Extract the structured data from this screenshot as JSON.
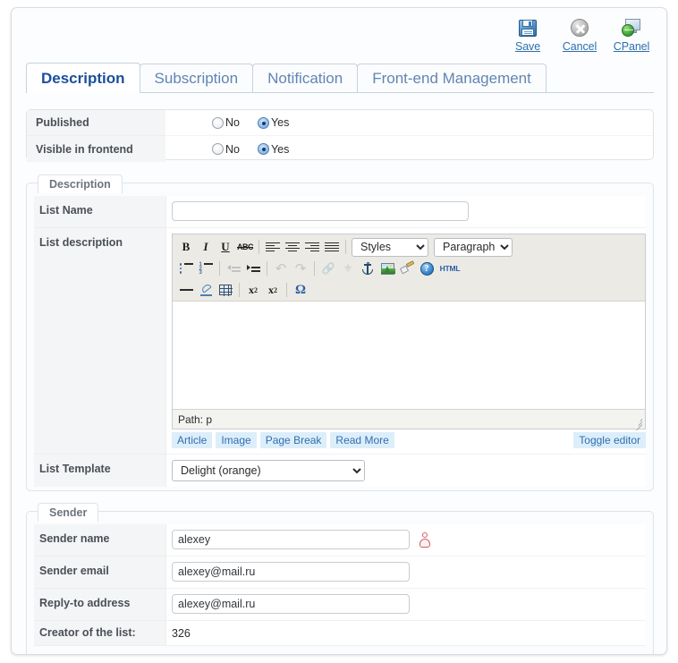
{
  "toolbar": {
    "buttons": [
      {
        "label": "Save",
        "icon": "floppy-disk-icon"
      },
      {
        "label": "Cancel",
        "icon": "cancel-circle-icon"
      },
      {
        "label": "CPanel",
        "icon": "cpanel-globe-icon"
      }
    ]
  },
  "tabs": [
    {
      "label": "Description",
      "active": true
    },
    {
      "label": "Subscription",
      "active": false
    },
    {
      "label": "Notification",
      "active": false
    },
    {
      "label": "Front-end Management",
      "active": false
    }
  ],
  "flags": {
    "rows": [
      {
        "label": "Published",
        "options": [
          "No",
          "Yes"
        ],
        "selected": "Yes"
      },
      {
        "label": "Visible in frontend",
        "options": [
          "No",
          "Yes"
        ],
        "selected": "Yes"
      }
    ]
  },
  "description_fieldset": {
    "legend": "Description",
    "list_name": {
      "label": "List Name",
      "value": "",
      "placeholder": ""
    },
    "list_description": {
      "label": "List description"
    },
    "list_template": {
      "label": "List Template",
      "value": "Delight (orange)",
      "options": [
        "Delight (orange)"
      ]
    }
  },
  "editor": {
    "row1": [
      {
        "name": "bold-icon",
        "title": "Bold"
      },
      {
        "name": "italic-icon",
        "title": "Italic"
      },
      {
        "name": "underline-icon",
        "title": "Underline"
      },
      {
        "name": "strikethrough-icon",
        "title": "Strikethrough"
      },
      {
        "name": "align-left-icon",
        "title": "Align left"
      },
      {
        "name": "align-center-icon",
        "title": "Align center"
      },
      {
        "name": "align-right-icon",
        "title": "Align right"
      },
      {
        "name": "align-justify-icon",
        "title": "Justify"
      }
    ],
    "styles_select": {
      "value": "Styles",
      "options": [
        "Styles"
      ]
    },
    "paragraph_select": {
      "value": "Paragraph",
      "options": [
        "Paragraph"
      ]
    },
    "row2": [
      {
        "name": "bullet-list-icon",
        "title": "Unordered list"
      },
      {
        "name": "numbered-list-icon",
        "title": "Ordered list"
      },
      {
        "name": "outdent-icon",
        "title": "Outdent",
        "disabled": true
      },
      {
        "name": "indent-icon",
        "title": "Indent"
      },
      {
        "name": "undo-icon",
        "title": "Undo",
        "disabled": true
      },
      {
        "name": "redo-icon",
        "title": "Redo",
        "disabled": true
      },
      {
        "name": "link-icon",
        "title": "Insert link",
        "disabled": true
      },
      {
        "name": "unlink-icon",
        "title": "Unlink",
        "disabled": true
      },
      {
        "name": "anchor-icon",
        "title": "Insert anchor"
      },
      {
        "name": "image-icon",
        "title": "Insert image"
      },
      {
        "name": "cleanup-brush-icon",
        "title": "Cleanup code"
      },
      {
        "name": "help-icon",
        "title": "Help"
      },
      {
        "name": "html-source-icon",
        "title": "Edit HTML source",
        "text": "HTML"
      }
    ],
    "row3": [
      {
        "name": "horizontal-rule-icon",
        "title": "Insert horizontal rule"
      },
      {
        "name": "eraser-icon",
        "title": "Remove formatting"
      },
      {
        "name": "table-icon",
        "title": "Insert table"
      },
      {
        "name": "subscript-icon",
        "title": "Subscript"
      },
      {
        "name": "superscript-icon",
        "title": "Superscript"
      },
      {
        "name": "special-char-icon",
        "title": "Insert special character",
        "text": "Ω"
      }
    ],
    "content": "",
    "status_path": "Path: p",
    "extended_buttons": [
      {
        "label": "Article"
      },
      {
        "label": "Image"
      },
      {
        "label": "Page Break"
      },
      {
        "label": "Read More"
      }
    ],
    "toggle_label": "Toggle editor"
  },
  "sender_fieldset": {
    "legend": "Sender",
    "rows": [
      {
        "label": "Sender name",
        "value": "alexey",
        "type": "input",
        "icon": "user-icon"
      },
      {
        "label": "Sender email",
        "value": "alexey@mail.ru",
        "type": "input"
      },
      {
        "label": "Reply-to address",
        "value": "alexey@mail.ru",
        "type": "input"
      },
      {
        "label": "Creator of the list:",
        "value": "326",
        "type": "text"
      }
    ]
  },
  "colors": {
    "accent": "#2f6fad",
    "tab_active": "#1b4f9c",
    "label": "#4a4f57",
    "toolbar_bg": "#eceae4",
    "user_icon": "#cf5f62"
  }
}
